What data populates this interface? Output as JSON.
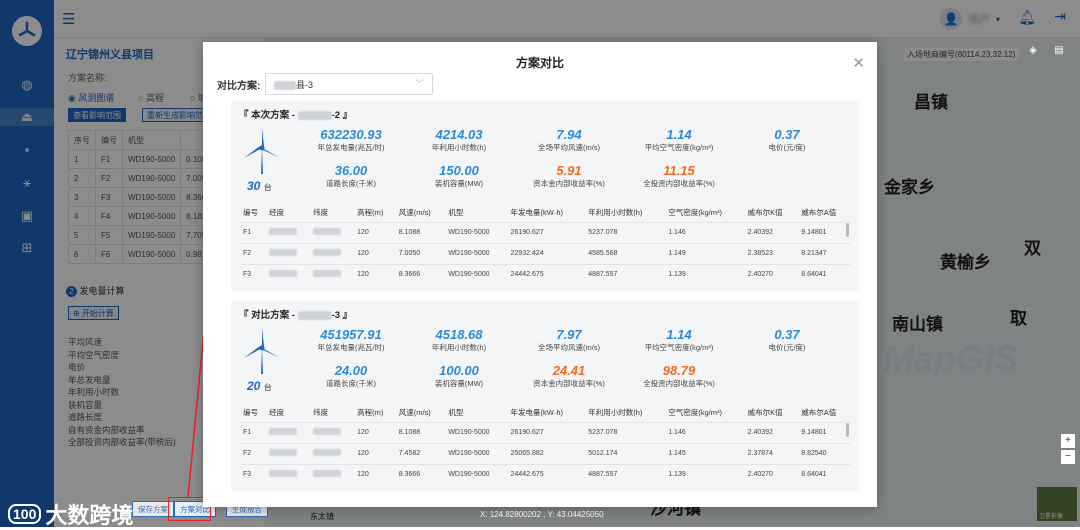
{
  "topbar": {
    "menu_icon": "menu-icon",
    "user_name": "用户",
    "bell_icon": "bell-icon",
    "logout_icon": "logout-icon"
  },
  "rail": {
    "items": [
      "globe-icon",
      "area-icon",
      "folder-icon",
      "wind-icon",
      "store-icon",
      "grid-icon"
    ]
  },
  "left_panel": {
    "project_title": "辽宁锦州义县项目",
    "scheme_name_label": "方案名称:",
    "radio_1": "风测图谱",
    "radio_2": "高程",
    "radio_3": "坡",
    "btn_view": "查看影响范围",
    "btn_regen": "重新生成影响范围",
    "table_head": [
      "序号",
      "编号",
      "机型"
    ],
    "table_rows": [
      [
        "1",
        "F1",
        "WD190-5000",
        "0.1088"
      ],
      [
        "2",
        "F2",
        "WD190-5000",
        "7.0050"
      ],
      [
        "3",
        "F3",
        "WD190-5000",
        "8.3666"
      ],
      [
        "4",
        "F4",
        "WD190-5000",
        "8.1821"
      ],
      [
        "5",
        "F5",
        "WD190-5000",
        "7.7057"
      ],
      [
        "6",
        "F6",
        "WD190-5000",
        "0.9814"
      ]
    ],
    "section2": "发电量计算",
    "start_btn": "开始计算",
    "stats": [
      "平均风速",
      "平均空气密度",
      "电价",
      "年总发电量",
      "年利用小时数",
      "装机容量",
      "道路长度",
      "自有资金内部收益率",
      "全部投资内部收益率(带税后)"
    ]
  },
  "bottom": {
    "btn_save": "保存方案",
    "btn_compare": "方案对比",
    "btn_report": "生成报告",
    "coords": "X: 124.82800202 ,  Y: 43.04425050",
    "brand": "大数跨境"
  },
  "map": {
    "labels": [
      {
        "text": "昌镇"
      },
      {
        "text": "金家乡"
      },
      {
        "text": "双"
      },
      {
        "text": "黄榆乡"
      },
      {
        "text": "取"
      },
      {
        "text": "南山镇"
      },
      {
        "text": "沙河镇"
      },
      {
        "text": "东太镇"
      }
    ],
    "top_info": "入场地商编号(80114.23,32.12)",
    "watermark": "MapGIS",
    "basemap_label": "卫星影像"
  },
  "modal": {
    "title": "方案对比",
    "compare_label": "对比方案:",
    "compare_value": "县-3",
    "close_icon": "close-icon",
    "cards": [
      {
        "title_prefix": "『 本次方案 -",
        "title_suffix": "-2 』",
        "turbine_count": "30",
        "turbine_unit": "台",
        "metrics": [
          {
            "value": "632230.93",
            "label": "年总发电量(兆瓦/时)",
            "color": "#2d8ad8"
          },
          {
            "value": "4214.03",
            "label": "年利用小时数(h)",
            "color": "#2d8ad8"
          },
          {
            "value": "7.94",
            "label": "全场平均风速(m/s)",
            "color": "#2d8ad8"
          },
          {
            "value": "1.14",
            "label": "平均空气密度(kg/m³)",
            "color": "#2d8ad8"
          },
          {
            "value": "0.37",
            "label": "电价(元/度)",
            "color": "#2d8ad8"
          },
          {
            "value": "36.00",
            "label": "道路长度(千米)",
            "color": "#2d8ad8"
          },
          {
            "value": "150.00",
            "label": "装机容量(MW)",
            "color": "#2d8ad8"
          },
          {
            "value": "5.91",
            "label": "资本金内部收益率(%)",
            "color": "#f26a21"
          },
          {
            "value": "11.15",
            "label": "全投资内部收益率(%)",
            "color": "#f26a21"
          }
        ],
        "headers": [
          "编号",
          "经度",
          "纬度",
          "高程(m)",
          "风速(m/s)",
          "机型",
          "年发电量(kW·h)",
          "年利用小时数(h)",
          "空气密度(kg/m³)",
          "威布尔K值",
          "威布尔A值"
        ],
        "rows": [
          [
            "F1",
            "",
            "",
            "120",
            "8.1088",
            "WD190-5000",
            "26190.627",
            "5237.078",
            "1.146",
            "2.40392",
            "9.14801"
          ],
          [
            "F2",
            "",
            "",
            "120",
            "7.0050",
            "WD190-5000",
            "22932.424",
            "4585.568",
            "1.149",
            "2.38523",
            "8.21347"
          ],
          [
            "F3",
            "",
            "",
            "120",
            "8.3666",
            "WD190-5000",
            "24442.675",
            "4887.557",
            "1.139",
            "2.40270",
            "8.64041"
          ]
        ]
      },
      {
        "title_prefix": "『 对比方案 -",
        "title_suffix": "-3 』",
        "turbine_count": "20",
        "turbine_unit": "台",
        "metrics": [
          {
            "value": "451957.91",
            "label": "年总发电量(兆瓦/时)",
            "color": "#2d8ad8"
          },
          {
            "value": "4518.68",
            "label": "年利用小时数(h)",
            "color": "#2d8ad8"
          },
          {
            "value": "7.97",
            "label": "全场平均风速(m/s)",
            "color": "#2d8ad8"
          },
          {
            "value": "1.14",
            "label": "平均空气密度(kg/m³)",
            "color": "#2d8ad8"
          },
          {
            "value": "0.37",
            "label": "电价(元/度)",
            "color": "#2d8ad8"
          },
          {
            "value": "24.00",
            "label": "道路长度(千米)",
            "color": "#2d8ad8"
          },
          {
            "value": "100.00",
            "label": "装机容量(MW)",
            "color": "#2d8ad8"
          },
          {
            "value": "24.41",
            "label": "资本金内部收益率(%)",
            "color": "#f26a21"
          },
          {
            "value": "98.79",
            "label": "全投资内部收益率(%)",
            "color": "#f26a21"
          }
        ],
        "headers": [
          "编号",
          "经度",
          "纬度",
          "高程(m)",
          "风速(m/s)",
          "机型",
          "年发电量(kW·h)",
          "年利用小时数(h)",
          "空气密度(kg/m³)",
          "威布尔K值",
          "威布尔A值"
        ],
        "rows": [
          [
            "F1",
            "",
            "",
            "120",
            "8.1088",
            "WD190-5000",
            "26190.627",
            "5237.078",
            "1.146",
            "2.40392",
            "9.14801"
          ],
          [
            "F2",
            "",
            "",
            "120",
            "7.4582",
            "WD190-5000",
            "25065.882",
            "5012.174",
            "1.145",
            "2.37874",
            "8.82540"
          ],
          [
            "F3",
            "",
            "",
            "120",
            "8.3666",
            "WD190-5000",
            "24442.675",
            "4887.557",
            "1.139",
            "2.40270",
            "8.64041"
          ]
        ]
      }
    ]
  }
}
